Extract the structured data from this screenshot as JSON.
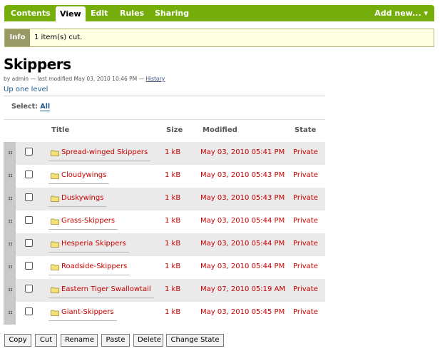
{
  "tabs": {
    "contents": "Contents",
    "view": "View",
    "edit": "Edit",
    "rules": "Rules",
    "sharing": "Sharing",
    "add_new": "Add new... ▾"
  },
  "info": {
    "label": "Info",
    "message": "1 item(s) cut."
  },
  "page": {
    "title": "Skippers",
    "byline_prefix": "by",
    "author": "admin",
    "modified": "— last modified May 03, 2010 10:46 PM —",
    "history": "History",
    "up_one_level": "Up one level",
    "select_label": "Select:",
    "select_all": "All"
  },
  "table": {
    "headers": {
      "title": "Title",
      "size": "Size",
      "modified": "Modified",
      "state": "State"
    },
    "handle_glyph": "⠶",
    "rows": [
      {
        "title": "Spread-winged Skippers",
        "size": "1 kB",
        "modified": "May 03, 2010 05:41 PM",
        "state": "Private"
      },
      {
        "title": "Cloudywings",
        "size": "1 kB",
        "modified": "May 03, 2010 05:43 PM",
        "state": "Private"
      },
      {
        "title": "Duskywings",
        "size": "1 kB",
        "modified": "May 03, 2010 05:43 PM",
        "state": "Private"
      },
      {
        "title": "Grass-Skippers",
        "size": "1 kB",
        "modified": "May 03, 2010 05:44 PM",
        "state": "Private"
      },
      {
        "title": "Hesperia Skippers",
        "size": "1 kB",
        "modified": "May 03, 2010 05:44 PM",
        "state": "Private"
      },
      {
        "title": "Roadside-Skippers",
        "size": "1 kB",
        "modified": "May 03, 2010 05:44 PM",
        "state": "Private"
      },
      {
        "title": "Eastern Tiger Swallowtail",
        "size": "1 kB",
        "modified": "May 07, 2010 05:19 AM",
        "state": "Private"
      },
      {
        "title": "Giant-Skippers",
        "size": "1 kB",
        "modified": "May 03, 2010 05:45 PM",
        "state": "Private"
      }
    ]
  },
  "buttons": {
    "copy": "Copy",
    "cut": "Cut",
    "rename": "Rename",
    "paste": "Paste",
    "delete": "Delete",
    "change_state": "Change State"
  },
  "colors": {
    "tabbar": "#75ad0a",
    "item_text": "#c80000",
    "link": "#205c90",
    "info_background": "#ffffe3",
    "info_label": "#999966"
  },
  "icons": {
    "row_icon": "folder-icon",
    "drag": "drag-handle-icon",
    "dropdown": "chevron-down-icon"
  }
}
